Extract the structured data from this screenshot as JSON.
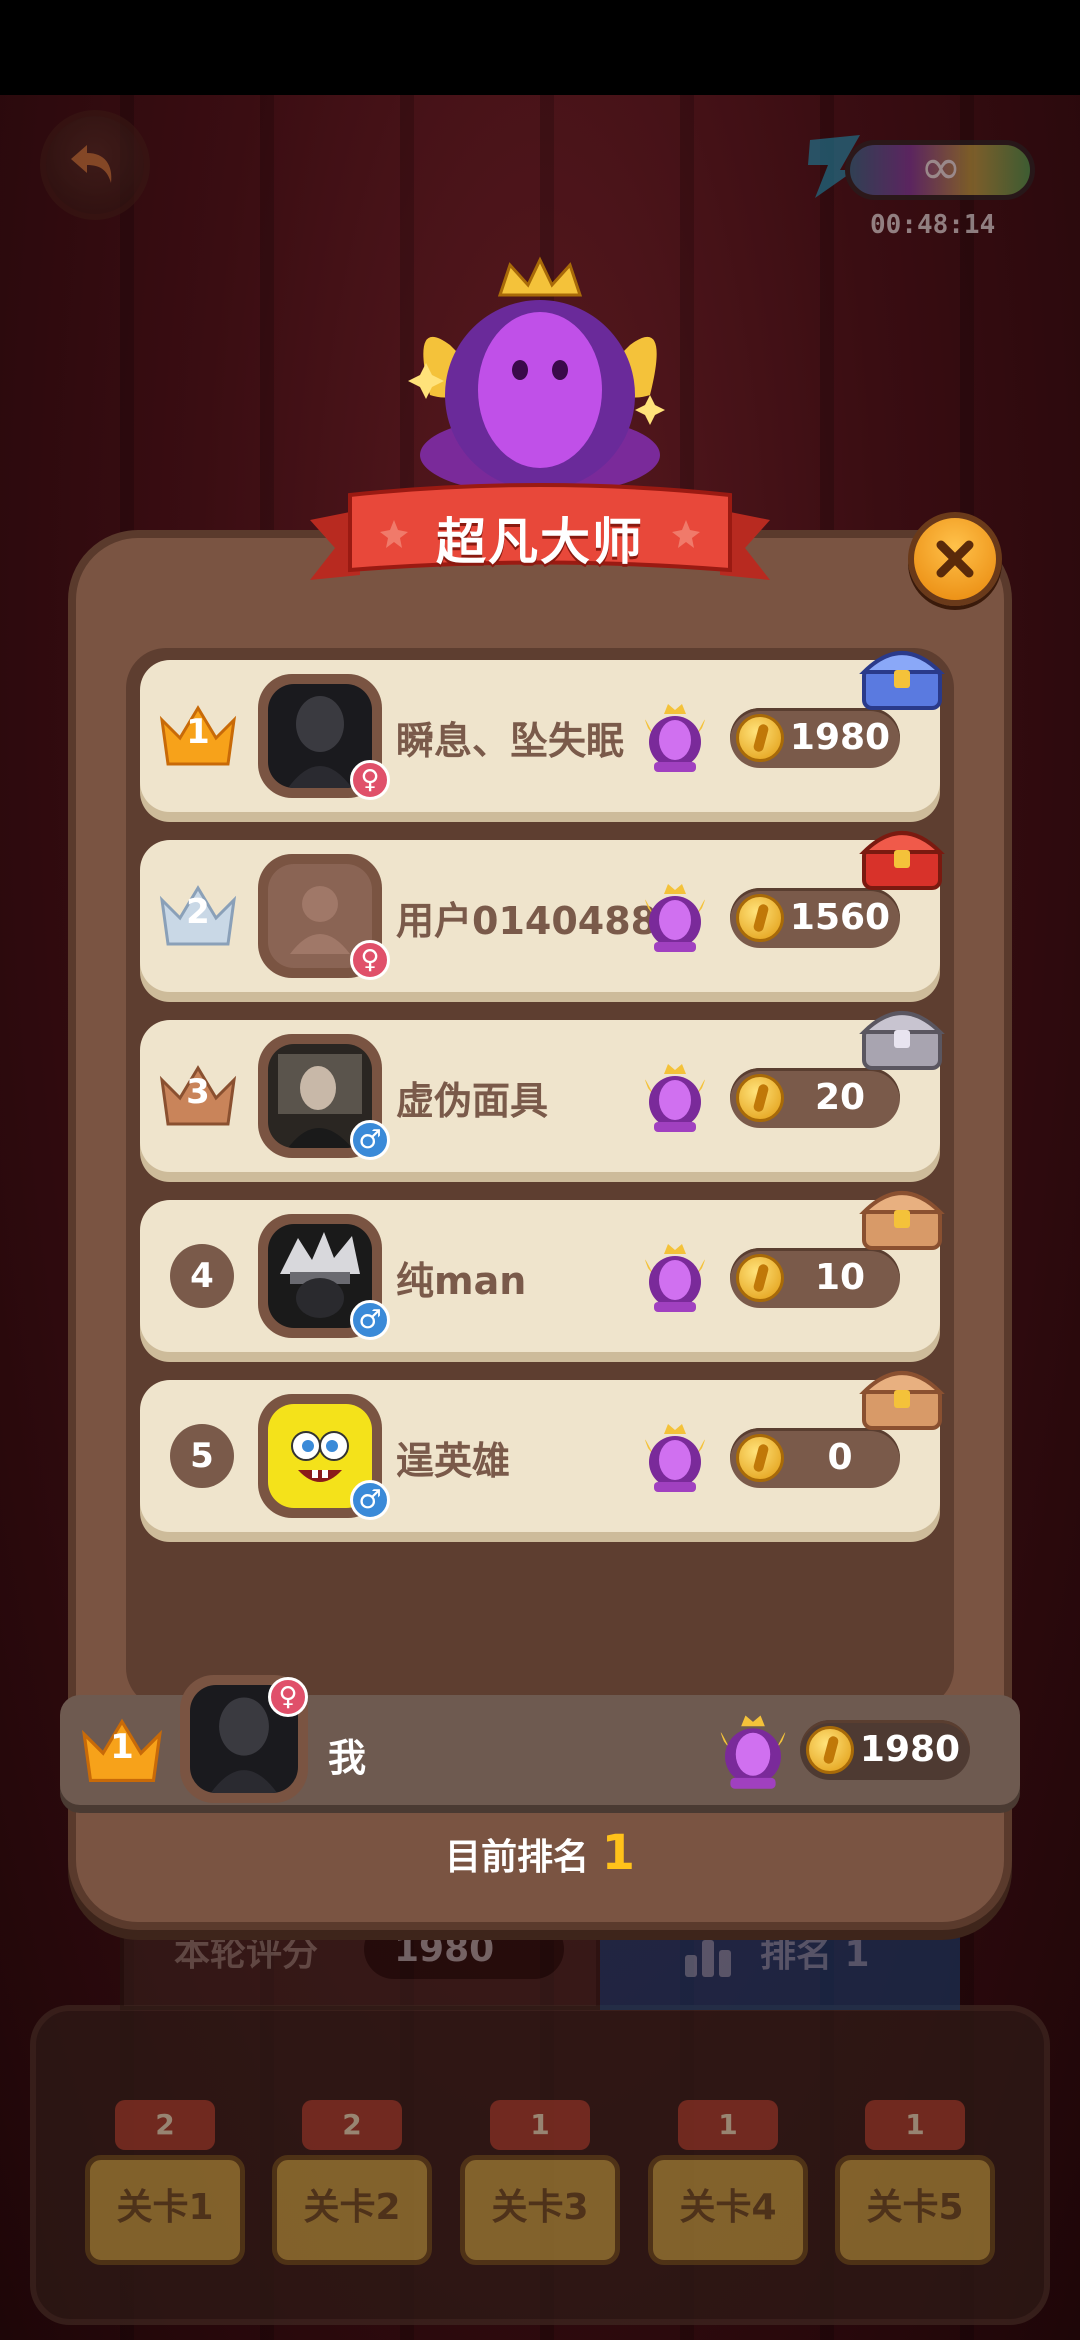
{
  "status_bar": {},
  "top": {
    "back_icon": "back-arrow-icon",
    "energy": {
      "symbol": "∞",
      "timer": "00:48:14"
    }
  },
  "modal": {
    "title": "超凡大师",
    "close_icon": "close-icon",
    "rows": [
      {
        "rank": "1",
        "name": "瞬息、坠失眠",
        "score": "1980",
        "gender": "female",
        "chest": "blue-chest-icon"
      },
      {
        "rank": "2",
        "name": "用户0140488",
        "score": "1560",
        "gender": "female",
        "chest": "red-chest-icon"
      },
      {
        "rank": "3",
        "name": "虚伪面具",
        "score": "20",
        "gender": "male",
        "chest": "silver-chest-icon"
      },
      {
        "rank": "4",
        "name": "纯man",
        "score": "10",
        "gender": "male",
        "chest": "wooden-chest-icon"
      },
      {
        "rank": "5",
        "name": "逞英雄",
        "score": "0",
        "gender": "male",
        "chest": "wooden-chest-icon"
      }
    ],
    "me": {
      "rank": "1",
      "name": "我",
      "score": "1980",
      "gender": "female"
    },
    "current_rank_label": "目前排名",
    "current_rank_value": "1"
  },
  "bottom": {
    "round_score_label": "本轮评分",
    "round_score_value": "1980",
    "rank_tab_label": "排名 1",
    "levels": [
      {
        "stars": "2",
        "label": "关卡1"
      },
      {
        "stars": "2",
        "label": "关卡2"
      },
      {
        "stars": "1",
        "label": "关卡3"
      },
      {
        "stars": "1",
        "label": "关卡4"
      },
      {
        "stars": "1",
        "label": "关卡5"
      }
    ]
  },
  "colors": {
    "panel": "#7a5442",
    "row": "#efe4cc",
    "ribbon": "#e8483a",
    "gold": "#ffc21a",
    "close_button": "#f0a020"
  }
}
